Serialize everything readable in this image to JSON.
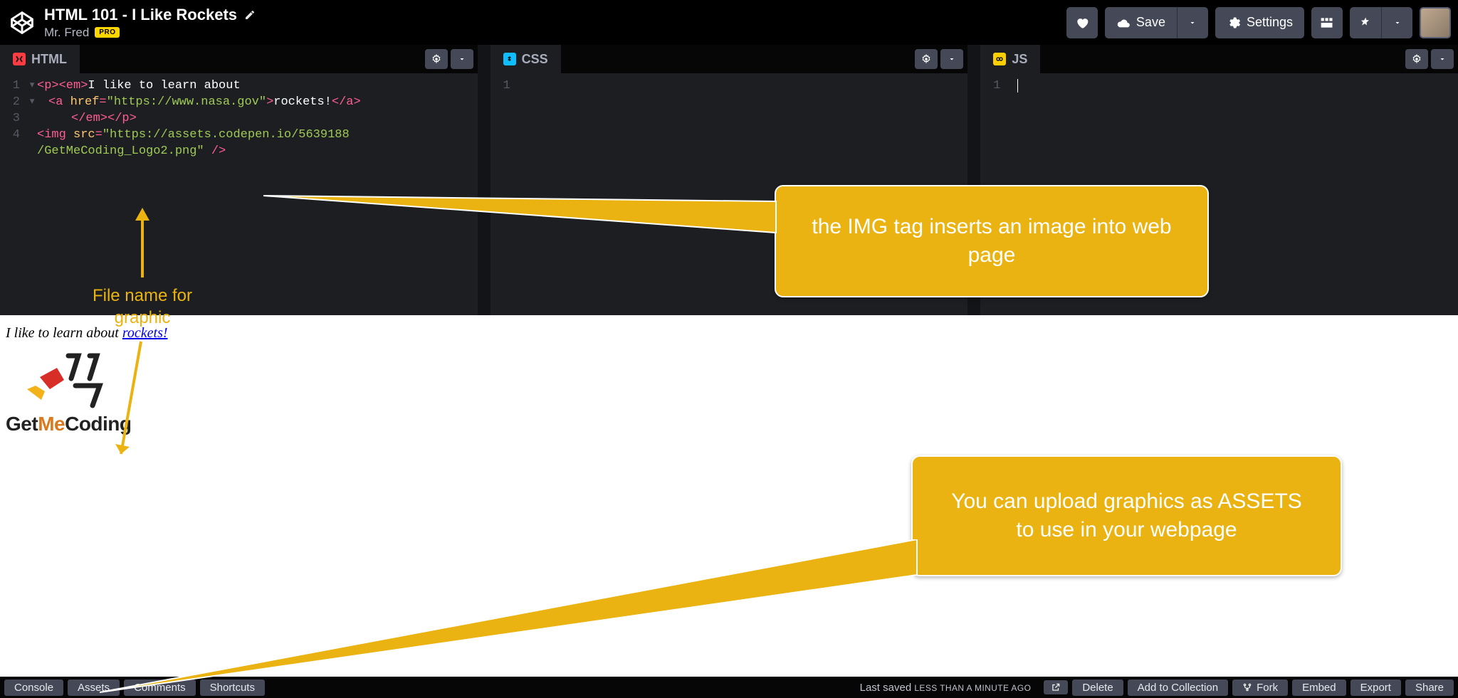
{
  "header": {
    "title": "HTML 101 - I Like Rockets",
    "author": "Mr. Fred",
    "pro_badge": "PRO",
    "save": "Save",
    "settings": "Settings"
  },
  "panes": {
    "html": "HTML",
    "css": "CSS",
    "js": "JS"
  },
  "code": {
    "l1_a": "<p><em>",
    "l1_b": "I like to learn about",
    "l2_a": "<a",
    "l2_attr": " href",
    "l2_eq": "=",
    "l2_str": "\"https://www.nasa.gov\"",
    "l2_c": ">",
    "l2_txt": "rockets!",
    "l2_d": "</a>",
    "l3": "</em></p>",
    "l4_a": "<img",
    "l4_attr": " src",
    "l4_eq": "=",
    "l4_str1": "\"https://assets.codepen.io/5639188",
    "l5_str": "/GetMeCoding_Logo2.png\"",
    "l5_b": " />"
  },
  "preview": {
    "text": "I like to learn about ",
    "link": "rockets!",
    "wordmark1": "Get",
    "wordmark2": "Me",
    "wordmark3": "Coding"
  },
  "annotations": {
    "file_name": "File name for\ngraphic",
    "img_tag": "the IMG tag inserts an image into web page",
    "assets": "You can upload graphics as ASSETS to use in your webpage"
  },
  "footer": {
    "console": "Console",
    "assets": "Assets",
    "comments": "Comments",
    "shortcuts": "Shortcuts",
    "saved_pre": "Last saved ",
    "saved_em": "LESS THAN A MINUTE AGO",
    "delete": "Delete",
    "add": "Add to Collection",
    "fork": "Fork",
    "embed": "Embed",
    "export": "Export",
    "share": "Share"
  }
}
